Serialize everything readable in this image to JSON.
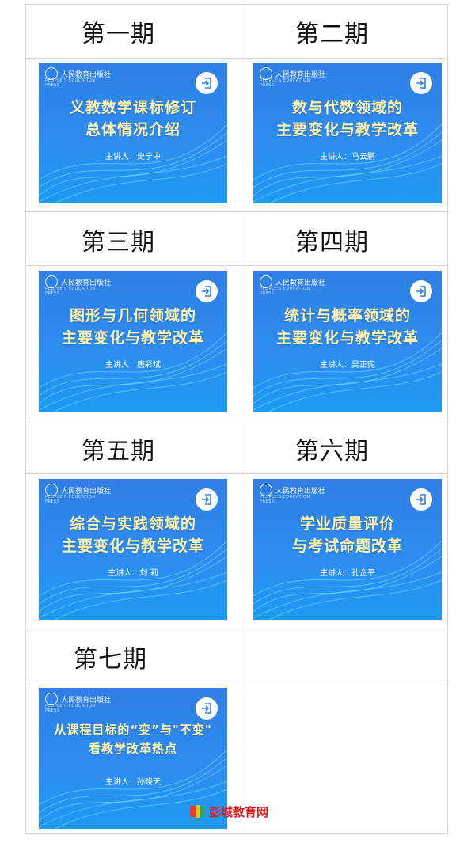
{
  "episodes": [
    {
      "label": "第一期",
      "line1": "义教数学课标修订",
      "line2": "总体情况介绍",
      "speaker": "主讲人：史宁中"
    },
    {
      "label": "第二期",
      "line1": "数与代数领域的",
      "line2": "主要变化与教学改革",
      "speaker": "主讲人：马云鹏"
    },
    {
      "label": "第三期",
      "line1": "图形与几何领域的",
      "line2": "主要变化与教学改革",
      "speaker": "主讲人：唐彩斌"
    },
    {
      "label": "第四期",
      "line1": "统计与概率领域的",
      "line2": "主要变化与教学改革",
      "speaker": "主讲人：吴正宪"
    },
    {
      "label": "第五期",
      "line1": "综合与实践领域的",
      "line2": "主要变化与教学改革",
      "speaker": "主讲人：刘 莉"
    },
    {
      "label": "第六期",
      "line1": "学业质量评价",
      "line2": "与考试命题改革",
      "speaker": "主讲人：孔企平"
    },
    {
      "label": "第七期",
      "line1": "从课程目标的“变”与\"不变\"",
      "line2": "看教学改革热点",
      "speaker": "主讲人：孙晓天"
    }
  ],
  "brand": {
    "name": "人民教育出版社",
    "english": "PEOPLE'S EDUCATION PRESS"
  },
  "watermark": {
    "text": "彭城教育网"
  },
  "colors": {
    "card_top": "#2f7fe6",
    "card_bottom": "#1c9af2",
    "title": "#fff6b3",
    "grid": "#d7d7d7",
    "watermark": "#e01b1b"
  },
  "icons": {
    "enter": "enter-icon",
    "seal": "seal-icon",
    "watermark_logo": "book-logo-icon"
  }
}
